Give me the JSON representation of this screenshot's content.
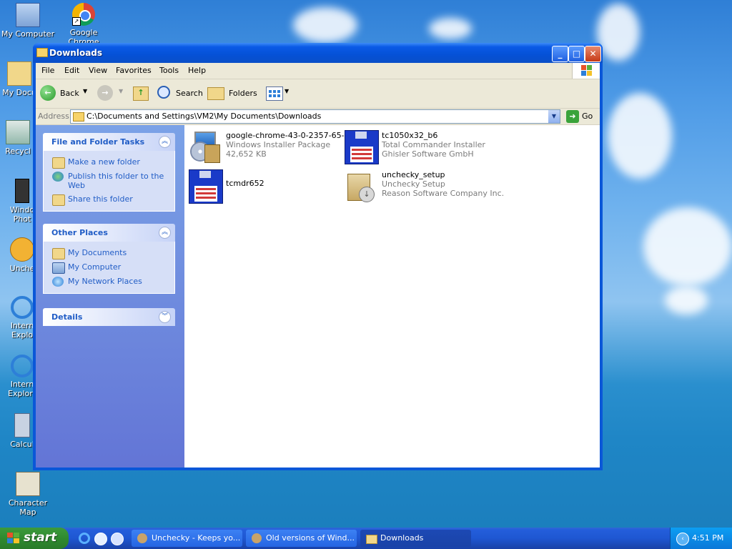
{
  "desktop": {
    "icons": [
      {
        "label": "My Computer"
      },
      {
        "label": "Google Chrome"
      },
      {
        "label": "My Docu"
      },
      {
        "label": "Recycl"
      },
      {
        "label": "Windo Phot"
      },
      {
        "label": "Unche"
      },
      {
        "label": "Intern Explo"
      },
      {
        "label": "Intern Explore"
      },
      {
        "label": "Calcul"
      },
      {
        "label": "Character Map"
      }
    ]
  },
  "window": {
    "title": "Downloads",
    "menu": [
      "File",
      "Edit",
      "View",
      "Favorites",
      "Tools",
      "Help"
    ],
    "toolbar": {
      "back": "Back",
      "search": "Search",
      "folders": "Folders"
    },
    "address": {
      "label": "Address",
      "value": "C:\\Documents and Settings\\VM2\\My Documents\\Downloads",
      "go": "Go"
    },
    "tasks_panel": {
      "title": "File and Folder Tasks",
      "items": [
        "Make a new folder",
        "Publish this folder to the Web",
        "Share this folder"
      ]
    },
    "places_panel": {
      "title": "Other Places",
      "items": [
        "My Documents",
        "My Computer",
        "My Network Places"
      ]
    },
    "details_panel": {
      "title": "Details"
    },
    "files": [
      {
        "name": "google-chrome-43-0-2357-65-...",
        "type": "Windows Installer Package",
        "extra": "42,652 KB"
      },
      {
        "name": "tc1050x32_b6",
        "type": "Total Commander Installer",
        "extra": "Ghisler Software GmbH"
      },
      {
        "name": "tcmdr652",
        "type": "",
        "extra": ""
      },
      {
        "name": "unchecky_setup",
        "type": "Unchecky Setup",
        "extra": "Reason Software Company Inc."
      }
    ]
  },
  "taskbar": {
    "start": "start",
    "tasks": [
      {
        "label": "Unchecky - Keeps yo..."
      },
      {
        "label": "Old versions of Wind..."
      },
      {
        "label": "Downloads"
      }
    ],
    "clock": "4:51 PM"
  }
}
